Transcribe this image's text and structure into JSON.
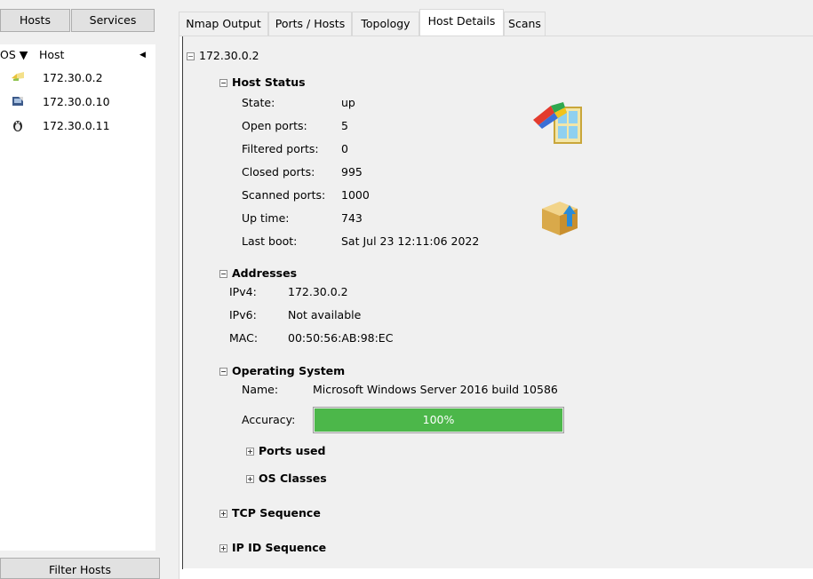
{
  "left_tabs": {
    "hosts": "Hosts",
    "services": "Services"
  },
  "host_list": {
    "col_os": "OS ▼",
    "col_host": "Host",
    "sort_arrow": "◀",
    "hosts": [
      {
        "ip": "172.30.0.2",
        "os_icon": "windows-icon"
      },
      {
        "ip": "172.30.0.10",
        "os_icon": "vmware-icon"
      },
      {
        "ip": "172.30.0.11",
        "os_icon": "linux-penguin-icon"
      }
    ]
  },
  "filter_button": "Filter Hosts",
  "tabs": [
    "Nmap Output",
    "Ports / Hosts",
    "Topology",
    "Host Details",
    "Scans"
  ],
  "active_tab": "Host Details",
  "details": {
    "host": "172.30.0.2",
    "host_status": {
      "title": "Host Status",
      "state_label": "State:",
      "state": "up",
      "open_label": "Open ports:",
      "open": "5",
      "filtered_label": "Filtered ports:",
      "filtered": "0",
      "closed_label": "Closed ports:",
      "closed": "995",
      "scanned_label": "Scanned ports:",
      "scanned": "1000",
      "uptime_label": "Up time:",
      "uptime": "743",
      "lastboot_label": "Last boot:",
      "lastboot": "Sat Jul 23 12:11:06 2022"
    },
    "addresses": {
      "title": "Addresses",
      "ipv4_label": "IPv4:",
      "ipv4": "172.30.0.2",
      "ipv6_label": "IPv6:",
      "ipv6": "Not available",
      "mac_label": "MAC:",
      "mac": "00:50:56:AB:98:EC"
    },
    "os": {
      "title": "Operating System",
      "name_label": "Name:",
      "name": "Microsoft Windows Server 2016 build 10586",
      "accuracy_label": "Accuracy:",
      "accuracy": "100%",
      "accuracy_fraction": 1.0,
      "ports_used": "Ports used",
      "os_classes": "OS Classes"
    },
    "tcp_sequence": "TCP Sequence",
    "ipid_sequence": "IP ID Sequence"
  },
  "colors": {
    "progress_fill": "#4cb74a",
    "panel_bg": "#f0f0f0"
  }
}
